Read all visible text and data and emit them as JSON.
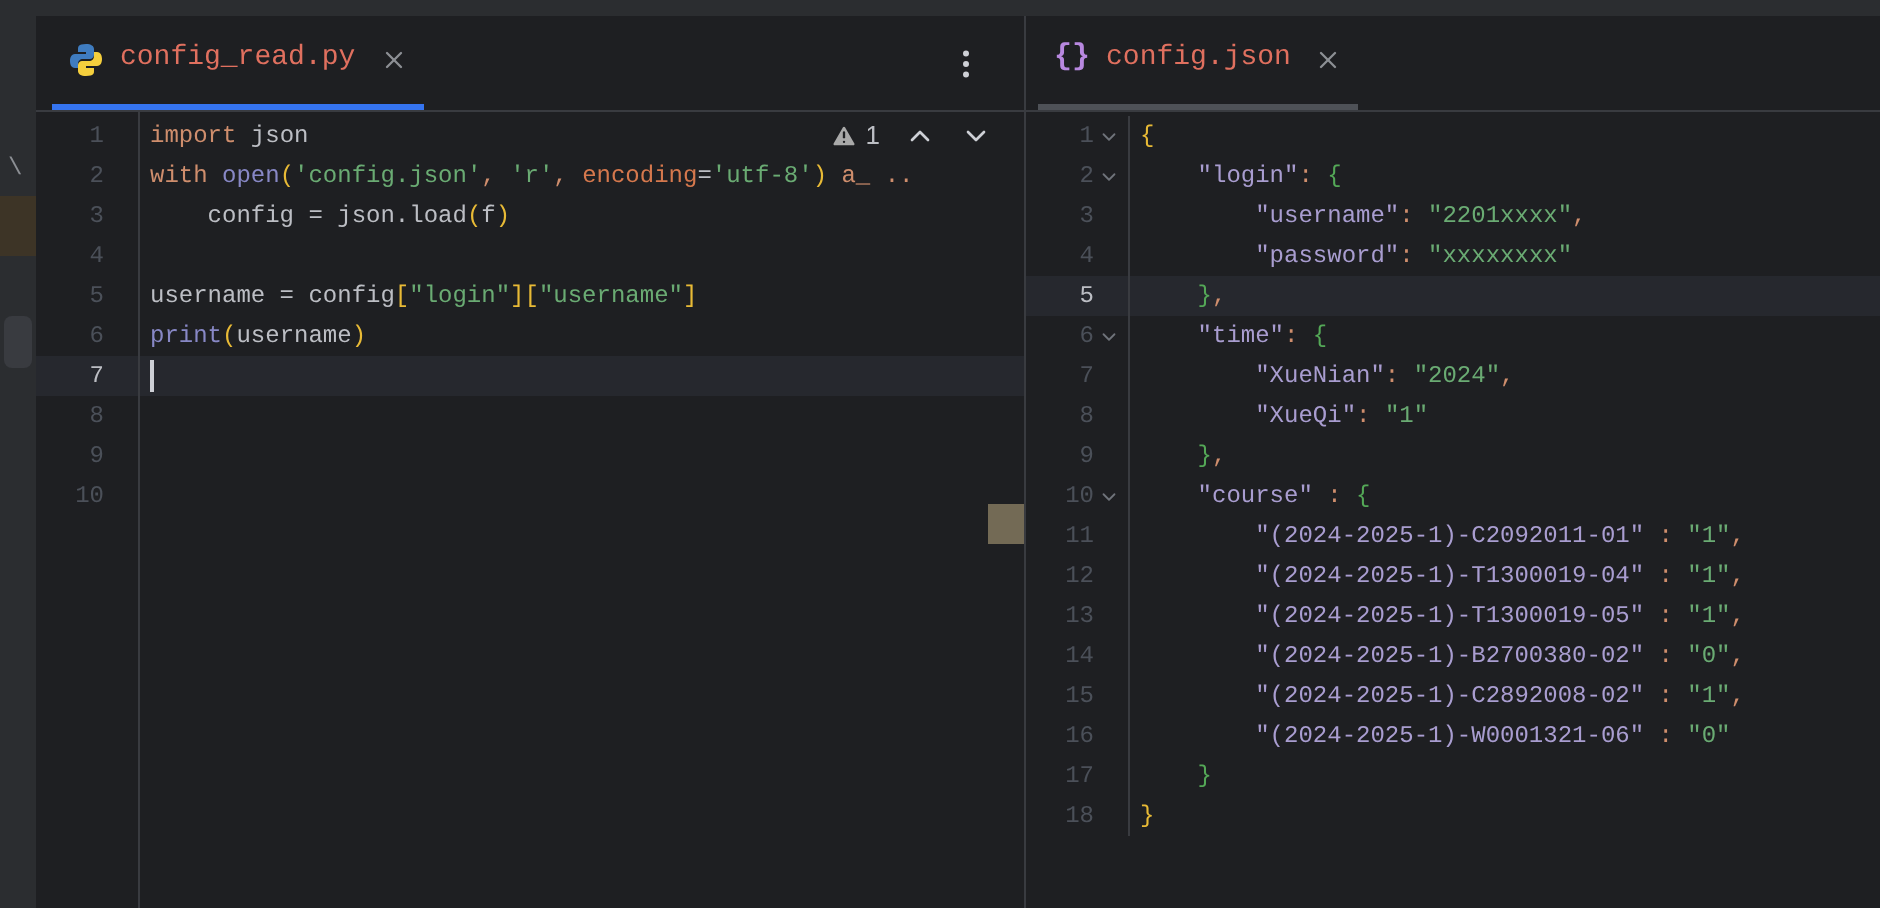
{
  "side_strip": {
    "text": "\\"
  },
  "left_editor": {
    "tab": {
      "label": "config_read.py",
      "selected": true
    },
    "warning_count": "1",
    "lines": [
      {
        "number": "1",
        "current": false,
        "tokens": [
          {
            "text": "import",
            "kind": "keyword"
          },
          {
            "text": " json",
            "kind": "plain"
          }
        ]
      },
      {
        "number": "2",
        "current": false,
        "tokens": [
          {
            "text": "with",
            "kind": "keyword"
          },
          {
            "text": " open",
            "kind": "builtin"
          },
          {
            "text": "(",
            "kind": "paren"
          },
          {
            "text": "'config.json'",
            "kind": "string"
          },
          {
            "text": ", ",
            "kind": "keyword"
          },
          {
            "text": "'r'",
            "kind": "string"
          },
          {
            "text": ", ",
            "kind": "keyword"
          },
          {
            "text": "encoding",
            "kind": "param"
          },
          {
            "text": "=",
            "kind": "plain"
          },
          {
            "text": "'utf-8'",
            "kind": "string"
          },
          {
            "text": ")",
            "kind": "paren"
          },
          {
            "text": " a_ ..",
            "kind": "keyword"
          }
        ]
      },
      {
        "number": "3",
        "current": false,
        "tokens": [
          {
            "text": "    config = json.load",
            "kind": "plain"
          },
          {
            "text": "(",
            "kind": "paren"
          },
          {
            "text": "f",
            "kind": "plain"
          },
          {
            "text": ")",
            "kind": "paren"
          }
        ]
      },
      {
        "number": "4",
        "current": false
      },
      {
        "number": "5",
        "current": false,
        "tokens": [
          {
            "text": "username = config",
            "kind": "plain"
          },
          {
            "text": "[",
            "kind": "paren"
          },
          {
            "text": "\"login\"",
            "kind": "string"
          },
          {
            "text": "][",
            "kind": "paren"
          },
          {
            "text": "\"username\"",
            "kind": "string"
          },
          {
            "text": "]",
            "kind": "paren"
          }
        ]
      },
      {
        "number": "6",
        "current": false,
        "tokens": [
          {
            "text": "print",
            "kind": "builtin"
          },
          {
            "text": "(",
            "kind": "paren"
          },
          {
            "text": "username",
            "kind": "plain"
          },
          {
            "text": ")",
            "kind": "paren"
          }
        ]
      },
      {
        "number": "7",
        "current": true
      },
      {
        "number": "8",
        "current": false
      },
      {
        "number": "9",
        "current": false
      },
      {
        "number": "10",
        "current": false
      }
    ]
  },
  "right_editor": {
    "tab": {
      "label": "config.json",
      "icon": "{}",
      "selected": false
    },
    "lines": [
      {
        "number": "1",
        "current": false,
        "fold": true,
        "tokens": [
          {
            "text": "{",
            "kind": "paren"
          }
        ]
      },
      {
        "number": "2",
        "current": false,
        "fold": true,
        "tokens": [
          {
            "text": "    \"login\"",
            "kind": "key"
          },
          {
            "text": ": ",
            "kind": "keyword"
          },
          {
            "text": "{",
            "kind": "brace"
          }
        ]
      },
      {
        "number": "3",
        "current": false,
        "fold": false,
        "tokens": [
          {
            "text": "        \"username\"",
            "kind": "key"
          },
          {
            "text": ": ",
            "kind": "keyword"
          },
          {
            "text": "\"2201xxxx\"",
            "kind": "string"
          },
          {
            "text": ",",
            "kind": "keyword"
          }
        ]
      },
      {
        "number": "4",
        "current": false,
        "fold": false,
        "tokens": [
          {
            "text": "        \"password\"",
            "kind": "key"
          },
          {
            "text": ": ",
            "kind": "keyword"
          },
          {
            "text": "\"xxxxxxxx\"",
            "kind": "string"
          }
        ]
      },
      {
        "number": "5",
        "current": true,
        "fold": false,
        "tokens": [
          {
            "text": "    }",
            "kind": "brace"
          },
          {
            "text": ",",
            "kind": "keyword"
          }
        ]
      },
      {
        "number": "6",
        "current": false,
        "fold": true,
        "tokens": [
          {
            "text": "    \"time\"",
            "kind": "key"
          },
          {
            "text": ": ",
            "kind": "keyword"
          },
          {
            "text": "{",
            "kind": "brace"
          }
        ]
      },
      {
        "number": "7",
        "current": false,
        "fold": false,
        "tokens": [
          {
            "text": "        \"XueNian\"",
            "kind": "key"
          },
          {
            "text": ": ",
            "kind": "keyword"
          },
          {
            "text": "\"2024\"",
            "kind": "string"
          },
          {
            "text": ",",
            "kind": "keyword"
          }
        ]
      },
      {
        "number": "8",
        "current": false,
        "fold": false,
        "tokens": [
          {
            "text": "        \"XueQi\"",
            "kind": "key"
          },
          {
            "text": ": ",
            "kind": "keyword"
          },
          {
            "text": "\"1\"",
            "kind": "string"
          }
        ]
      },
      {
        "number": "9",
        "current": false,
        "fold": false,
        "tokens": [
          {
            "text": "    }",
            "kind": "brace"
          },
          {
            "text": ",",
            "kind": "keyword"
          }
        ]
      },
      {
        "number": "10",
        "current": false,
        "fold": true,
        "tokens": [
          {
            "text": "    \"course\"",
            "kind": "key"
          },
          {
            "text": " : ",
            "kind": "keyword"
          },
          {
            "text": "{",
            "kind": "brace"
          }
        ]
      },
      {
        "number": "11",
        "current": false,
        "fold": false,
        "tokens": [
          {
            "text": "        \"(2024-2025-1)-C2092011-01\"",
            "kind": "key"
          },
          {
            "text": " : ",
            "kind": "keyword"
          },
          {
            "text": "\"1\"",
            "kind": "string"
          },
          {
            "text": ",",
            "kind": "keyword"
          }
        ]
      },
      {
        "number": "12",
        "current": false,
        "fold": false,
        "tokens": [
          {
            "text": "        \"(2024-2025-1)-T1300019-04\"",
            "kind": "key"
          },
          {
            "text": " : ",
            "kind": "keyword"
          },
          {
            "text": "\"1\"",
            "kind": "string"
          },
          {
            "text": ",",
            "kind": "keyword"
          }
        ]
      },
      {
        "number": "13",
        "current": false,
        "fold": false,
        "tokens": [
          {
            "text": "        \"(2024-2025-1)-T1300019-05\"",
            "kind": "key"
          },
          {
            "text": " : ",
            "kind": "keyword"
          },
          {
            "text": "\"1\"",
            "kind": "string"
          },
          {
            "text": ",",
            "kind": "keyword"
          }
        ]
      },
      {
        "number": "14",
        "current": false,
        "fold": false,
        "tokens": [
          {
            "text": "        \"(2024-2025-1)-B2700380-02\"",
            "kind": "key"
          },
          {
            "text": " : ",
            "kind": "keyword"
          },
          {
            "text": "\"0\"",
            "kind": "string"
          },
          {
            "text": ",",
            "kind": "keyword"
          }
        ]
      },
      {
        "number": "15",
        "current": false,
        "fold": false,
        "tokens": [
          {
            "text": "        \"(2024-2025-1)-C2892008-02\"",
            "kind": "key"
          },
          {
            "text": " : ",
            "kind": "keyword"
          },
          {
            "text": "\"1\"",
            "kind": "string"
          },
          {
            "text": ",",
            "kind": "keyword"
          }
        ]
      },
      {
        "number": "16",
        "current": false,
        "fold": false,
        "tokens": [
          {
            "text": "        \"(2024-2025-1)-W0001321-06\"",
            "kind": "key"
          },
          {
            "text": " : ",
            "kind": "keyword"
          },
          {
            "text": "\"0\"",
            "kind": "string"
          }
        ]
      },
      {
        "number": "17",
        "current": false,
        "fold": false,
        "tokens": [
          {
            "text": "    }",
            "kind": "brace"
          }
        ]
      },
      {
        "number": "18",
        "current": false,
        "fold": false,
        "tokens": [
          {
            "text": "}",
            "kind": "paren"
          }
        ]
      }
    ]
  }
}
